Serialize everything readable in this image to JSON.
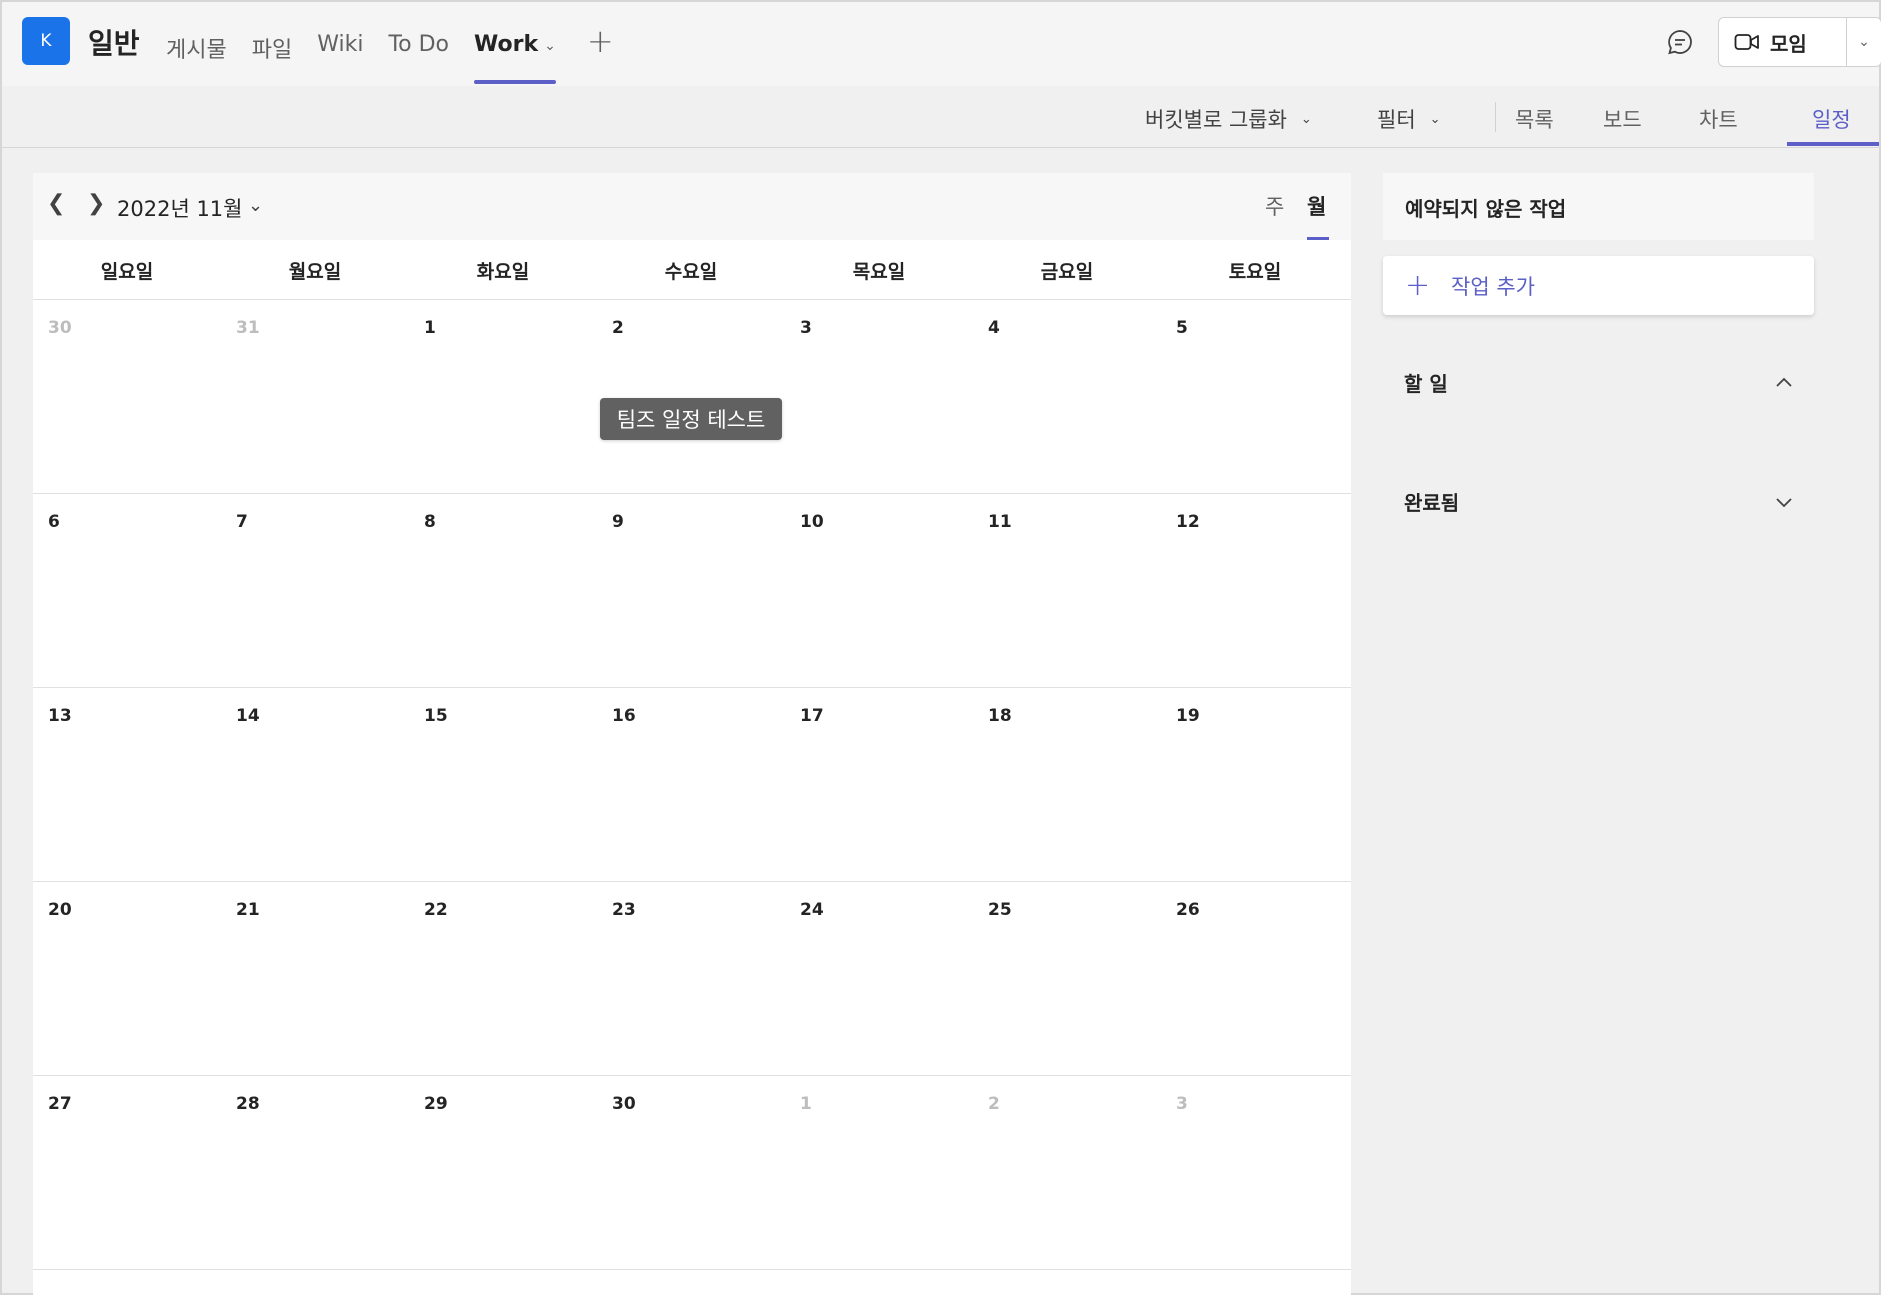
{
  "team": {
    "avatar_letter": "K",
    "channel": "일반"
  },
  "tabs": [
    {
      "label": "게시물"
    },
    {
      "label": "파일"
    },
    {
      "label": "Wiki"
    },
    {
      "label": "To Do"
    },
    {
      "label": "Work",
      "active": true
    }
  ],
  "header": {
    "meet_label": "모임"
  },
  "toolbar": {
    "group_by": "버킷별로 그룹화",
    "filter": "필터",
    "views": [
      "목록",
      "보드",
      "차트",
      "일정"
    ],
    "active_view": "일정"
  },
  "calendar": {
    "title": "2022년 11월",
    "view_week": "주",
    "view_month": "월",
    "active_range": "월",
    "weekdays": [
      "일요일",
      "월요일",
      "화요일",
      "수요일",
      "목요일",
      "금요일",
      "토요일"
    ],
    "weeks": [
      [
        {
          "n": "30",
          "muted": true
        },
        {
          "n": "31",
          "muted": true
        },
        {
          "n": "1"
        },
        {
          "n": "2"
        },
        {
          "n": "3"
        },
        {
          "n": "4"
        },
        {
          "n": "5"
        }
      ],
      [
        {
          "n": "6"
        },
        {
          "n": "7"
        },
        {
          "n": "8"
        },
        {
          "n": "9"
        },
        {
          "n": "10"
        },
        {
          "n": "11"
        },
        {
          "n": "12"
        }
      ],
      [
        {
          "n": "13"
        },
        {
          "n": "14"
        },
        {
          "n": "15"
        },
        {
          "n": "16"
        },
        {
          "n": "17"
        },
        {
          "n": "18"
        },
        {
          "n": "19"
        }
      ],
      [
        {
          "n": "20"
        },
        {
          "n": "21"
        },
        {
          "n": "22"
        },
        {
          "n": "23"
        },
        {
          "n": "24"
        },
        {
          "n": "25"
        },
        {
          "n": "26"
        }
      ],
      [
        {
          "n": "27"
        },
        {
          "n": "28"
        },
        {
          "n": "29"
        },
        {
          "n": "30"
        },
        {
          "n": "1",
          "muted": true
        },
        {
          "n": "2",
          "muted": true
        },
        {
          "n": "3",
          "muted": true
        }
      ]
    ],
    "task": {
      "label": "팀즈 일정 테스트",
      "date": "2"
    }
  },
  "panel": {
    "title": "예약되지 않은 작업",
    "add_task": "작업 추가",
    "sections": [
      {
        "label": "할 일",
        "expanded": true
      },
      {
        "label": "완료됨",
        "expanded": false
      }
    ]
  },
  "colors": {
    "accent": "#5b5fc7",
    "avatar": "#1a73e8",
    "chip": "#616161"
  }
}
